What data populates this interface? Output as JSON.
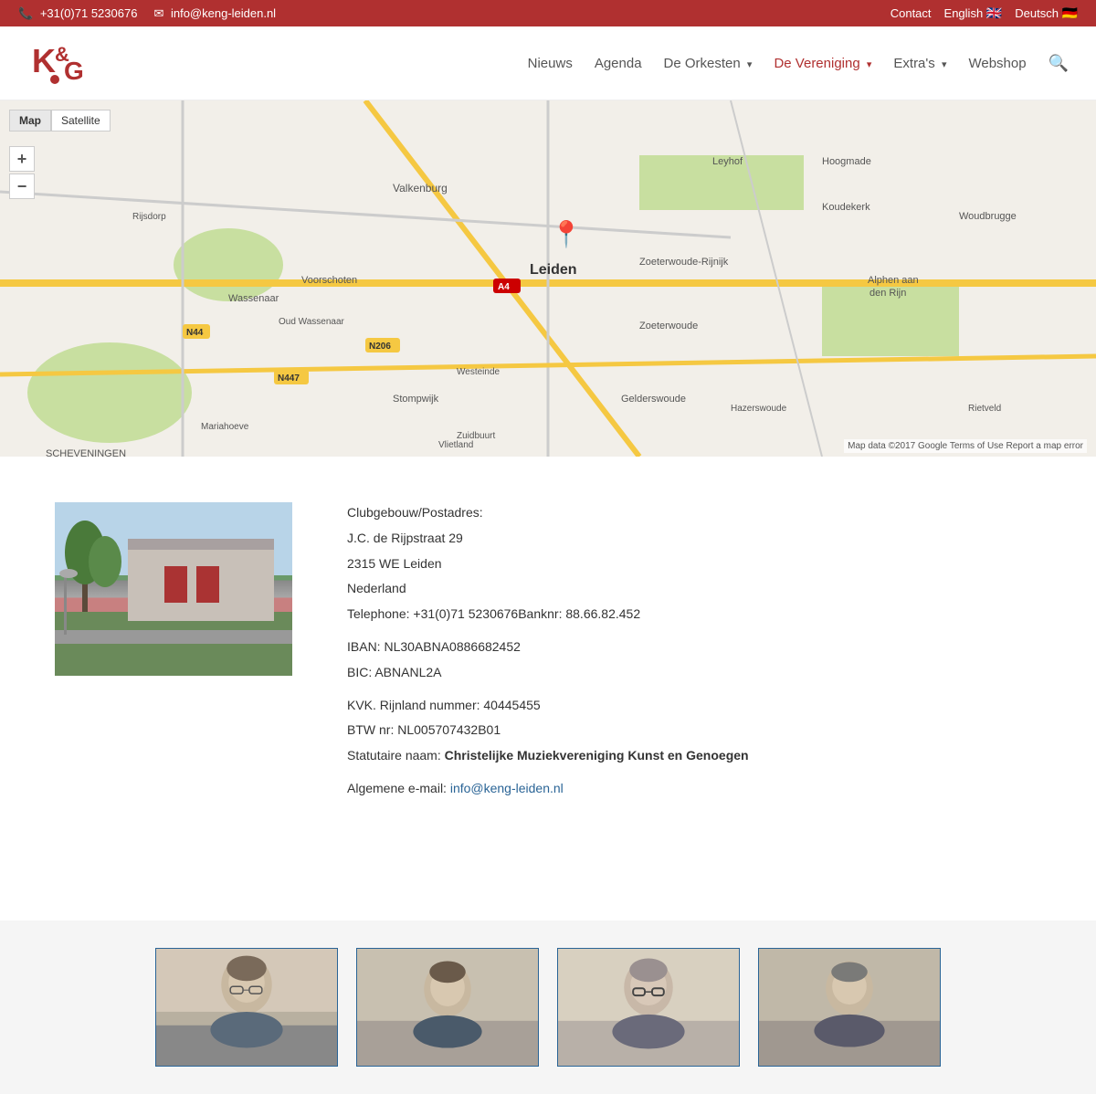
{
  "topbar": {
    "phone": "+31(0)71 5230676",
    "email": "info@keng-leiden.nl",
    "contact_label": "Contact",
    "english_label": "English",
    "deutsch_label": "Deutsch"
  },
  "nav": {
    "logo_alt": "KG Logo",
    "items": [
      {
        "label": "Nieuws",
        "active": false,
        "has_arrow": false
      },
      {
        "label": "Agenda",
        "active": false,
        "has_arrow": false
      },
      {
        "label": "De Orkesten",
        "active": false,
        "has_arrow": true
      },
      {
        "label": "De Vereniging",
        "active": true,
        "has_arrow": true
      },
      {
        "label": "Extra's",
        "active": false,
        "has_arrow": true
      },
      {
        "label": "Webshop",
        "active": false,
        "has_arrow": false
      }
    ]
  },
  "map": {
    "type_map": "Map",
    "type_satellite": "Satellite",
    "attribution": "Map data ©2017 Google  Terms of Use  Report a map error",
    "pin_city": "Leiden"
  },
  "address": {
    "heading": "Clubgebouw/Postadres:",
    "street": "J.C. de Rijpstraat 29",
    "postal": "2315 WE Leiden",
    "country": "Nederland",
    "telephone_line": "Telephone: +31(0)71 5230676",
    "bank_line": "Banknr: 88.66.82.452",
    "iban": "IBAN: NL30ABNA0886682452",
    "bic": "BIC: ABNANL2A",
    "kvk": "KVK. Rijnland nummer: 40445455",
    "btw": "BTW nr: NL005707432B01",
    "statutory_label": "Statutaire naam:",
    "statutory_name": "Christelijke Muziekvereniging Kunst en Genoegen",
    "email_label": "Algemene e-mail:",
    "email": "info@keng-leiden.nl"
  },
  "people": [
    {
      "id": 1
    },
    {
      "id": 2
    },
    {
      "id": 3
    },
    {
      "id": 4
    }
  ]
}
